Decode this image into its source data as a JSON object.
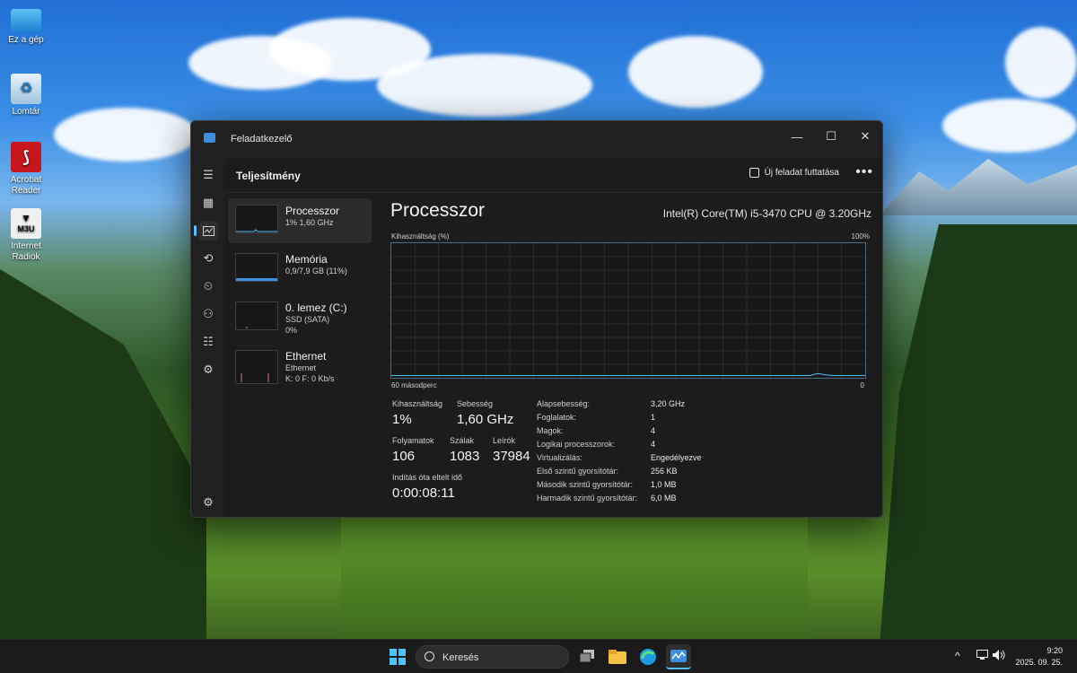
{
  "desktop": {
    "icons": [
      {
        "label": "Ez a gép"
      },
      {
        "label": "Lomtár"
      },
      {
        "label": "Acrobat Reader"
      },
      {
        "label": "Internet Radiok",
        "glyph_text": "M3U"
      }
    ]
  },
  "window": {
    "title": "Feladatkezelő",
    "controls": {
      "minimize": "—",
      "maximize": "☐",
      "close": "✕"
    },
    "header": {
      "page_title": "Teljesítmény",
      "run_task_label": "Új feladat futtatása",
      "more_label": "•••"
    },
    "sidebar_icons": [
      "menu-icon",
      "processes-icon",
      "performance-icon",
      "app-history-icon",
      "startup-icon",
      "users-icon",
      "details-icon",
      "services-icon",
      "settings-icon"
    ],
    "perf_items": [
      {
        "name": "Processzor",
        "sub1": "1%  1,60 GHz",
        "sub2": "",
        "color": "#4cc2ff"
      },
      {
        "name": "Memória",
        "sub1": "0,9/7,9 GB (11%)",
        "sub2": "",
        "color": "#3d8de0"
      },
      {
        "name": "0. lemez (C:)",
        "sub1": "SSD (SATA)",
        "sub2": "0%",
        "color": "#6ccb5f"
      },
      {
        "name": "Ethernet",
        "sub1": "Ethernet",
        "sub2": "K: 0 F: 0 Kb/s",
        "color": "#d36b9a"
      }
    ],
    "detail": {
      "title": "Processzor",
      "cpu_model": "Intel(R) Core(TM) i5-3470 CPU @ 3.20GHz",
      "graph": {
        "top_left": "Kihasználtság (%)",
        "top_right": "100%",
        "bottom_left": "60 másodperc",
        "bottom_right": "0",
        "line_color": "#4cc2ff",
        "grid_color": "#2c2c2c"
      },
      "stats": {
        "utilization_label": "Kihasználtság",
        "utilization_value": "1%",
        "speed_label": "Sebesség",
        "speed_value": "1,60 GHz",
        "processes_label": "Folyamatok",
        "processes_value": "106",
        "threads_label": "Szálak",
        "threads_value": "1083",
        "handles_label": "Leírók",
        "handles_value": "37984",
        "uptime_label": "Indítás óta eltelt idő",
        "uptime_value": "0:00:08:11"
      },
      "specs": [
        {
          "label": "Alapsebesség:",
          "value": "3,20 GHz"
        },
        {
          "label": "Foglalatok:",
          "value": "1"
        },
        {
          "label": "Magok:",
          "value": "4"
        },
        {
          "label": "Logikai processzorok:",
          "value": "4"
        },
        {
          "label": "Virtualizálás:",
          "value": "Engedélyezve"
        },
        {
          "label": "Első szintű gyorsítótár:",
          "value": "256 KB"
        },
        {
          "label": "Második szintű gyorsítótár:",
          "value": "1,0 MB"
        },
        {
          "label": "Harmadik szintű gyorsítótár:",
          "value": "6,0 MB"
        }
      ]
    }
  },
  "taskbar": {
    "search_placeholder": "Keresés",
    "tray_chevron": "^",
    "time": "9:20",
    "date": "2025. 09. 25."
  }
}
